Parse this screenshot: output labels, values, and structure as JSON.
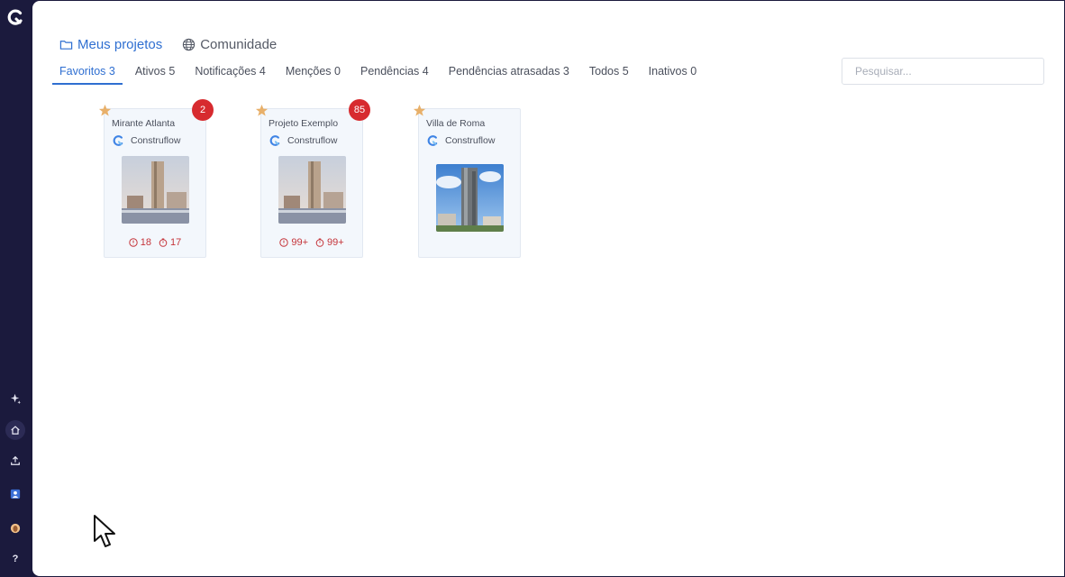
{
  "sidebar": {
    "items": [
      {
        "icon": "sparkle-icon"
      },
      {
        "icon": "home-icon",
        "active": true
      },
      {
        "icon": "upload-icon"
      },
      {
        "icon": "user-icon"
      },
      {
        "icon": "profile-avatar-icon"
      },
      {
        "icon": "help-icon",
        "label": "?"
      }
    ]
  },
  "header": {
    "tabs": [
      {
        "label": "Meus projetos",
        "icon": "folder-icon",
        "active": true
      },
      {
        "label": "Comunidade",
        "icon": "globe-icon",
        "active": false
      }
    ]
  },
  "filters": [
    {
      "label": "Favoritos 3",
      "active": true
    },
    {
      "label": "Ativos 5"
    },
    {
      "label": "Notificações 4"
    },
    {
      "label": "Menções 0"
    },
    {
      "label": "Pendências 4"
    },
    {
      "label": "Pendências atrasadas 3"
    },
    {
      "label": "Todos 5"
    },
    {
      "label": "Inativos 0"
    }
  ],
  "search": {
    "placeholder": "Pesquisar..."
  },
  "projects": [
    {
      "title": "Mirante Atlanta",
      "company": "Construflow",
      "badge": "2",
      "stat1": "18",
      "stat2": "17",
      "favorite": true
    },
    {
      "title": "Projeto Exemplo",
      "company": "Construflow",
      "badge": "85",
      "stat1": "99+",
      "stat2": "99+",
      "favorite": true
    },
    {
      "title": "Villa de Roma",
      "company": "Construflow",
      "favorite": true
    }
  ],
  "colors": {
    "sidebar_bg": "#1b1a3d",
    "accent": "#2f6fd1",
    "badge": "#d72b2f",
    "star": "#e8b06a",
    "stat": "#c5343a",
    "card_bg": "#f3f7fc"
  }
}
